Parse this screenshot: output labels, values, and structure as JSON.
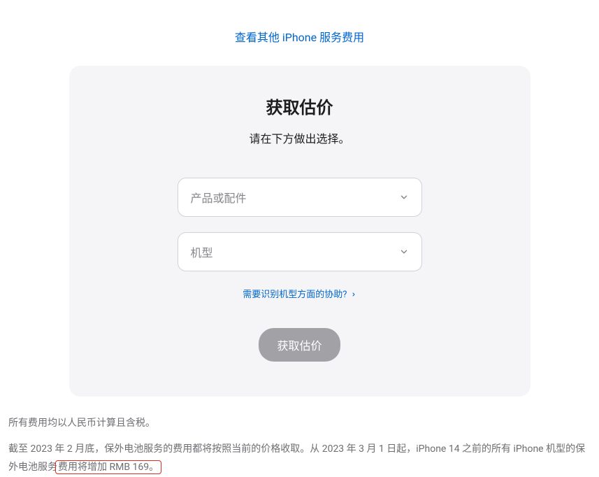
{
  "topLink": {
    "label": "查看其他 iPhone 服务费用"
  },
  "card": {
    "title": "获取估价",
    "subtitle": "请在下方做出选择。",
    "select1": {
      "placeholder": "产品或配件"
    },
    "select2": {
      "placeholder": "机型"
    },
    "helpLink": {
      "label": "需要识别机型方面的协助?"
    },
    "submit": {
      "label": "获取估价"
    }
  },
  "footer": {
    "line1": "所有费用均以人民币计算且含税。",
    "line2_part1": "截至 2023 年 2 月底，保外电池服务的费用都将按照当前的价格收取。从 2023 年 3 月 1 日起，iPhone 14 之前的所有 iPhone 机型的保外电池服务",
    "line2_highlight": "费用将增加 RMB 169。"
  }
}
